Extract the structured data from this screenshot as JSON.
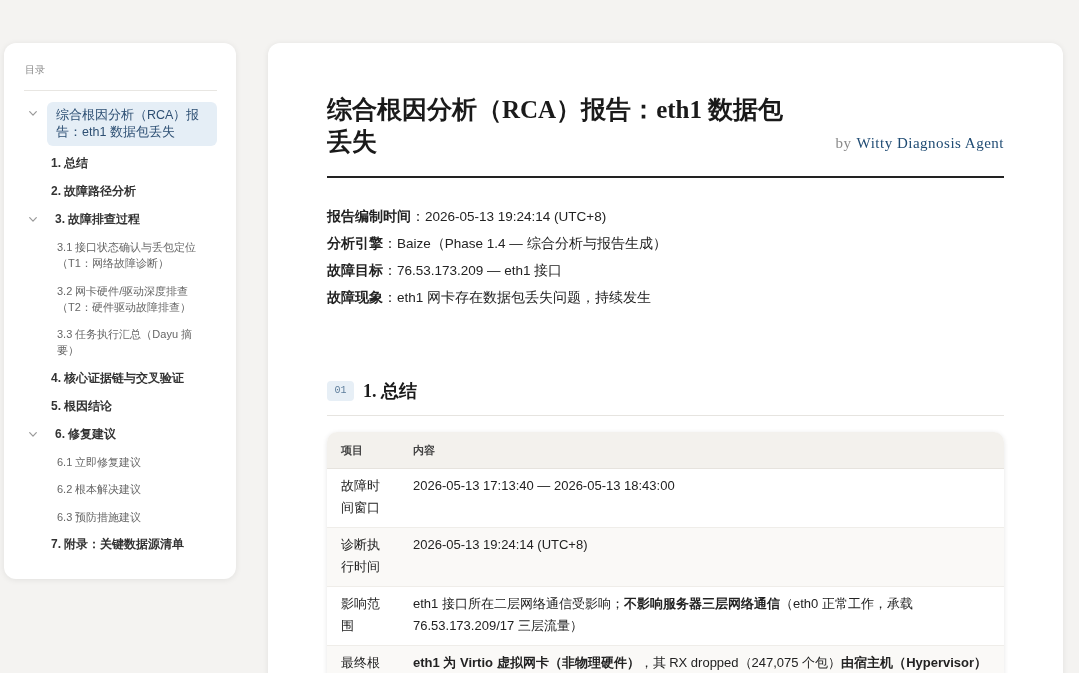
{
  "toc": {
    "title": "目录",
    "items": [
      {
        "label": "综合根因分析（RCA）报告：eth1 数据包丢失",
        "selected": true,
        "expanded": true,
        "children": [
          {
            "label": "1. 总结",
            "selected": false
          },
          {
            "label": "2. 故障路径分析",
            "selected": false
          },
          {
            "label": "3. 故障排查过程",
            "selected": false,
            "expanded": true,
            "children": [
              {
                "label": "3.1 接口状态确认与丢包定位（T1：网络故障诊断）",
                "selected": false
              },
              {
                "label": "3.2 网卡硬件/驱动深度排查（T2：硬件驱动故障排查）",
                "selected": false
              },
              {
                "label": "3.3 任务执行汇总（Dayu 摘要）",
                "selected": false
              }
            ]
          },
          {
            "label": "4. 核心证据链与交叉验证",
            "selected": false
          },
          {
            "label": "5. 根因结论",
            "selected": false
          },
          {
            "label": "6. 修复建议",
            "selected": false,
            "expanded": true,
            "children": [
              {
                "label": "6.1 立即修复建议",
                "selected": false
              },
              {
                "label": "6.2 根本解决建议",
                "selected": false
              },
              {
                "label": "6.3 预防措施建议",
                "selected": false
              }
            ]
          },
          {
            "label": "7. 附录：关键数据源清单",
            "selected": false
          }
        ]
      }
    ]
  },
  "report": {
    "title": "综合根因分析（RCA）报告：eth1 数据包丢失",
    "byline": {
      "prefix": "by",
      "author": "Witty Diagnosis Agent"
    },
    "meta": [
      "**报告编制时间**：2026-05-13 19:24:14 (UTC+8)",
      "**分析引擎**：Baize（Phase 1.4 — 综合分析与报告生成）",
      "**故障目标**：76.53.173.209 — eth1 接口",
      "**故障现象**：eth1 网卡存在数据包丢失问题，持续发生"
    ],
    "sections": [
      {
        "number": "01",
        "heading": "1. 总结",
        "table": {
          "columns": [
            "项目",
            "内容"
          ],
          "rows": [
            [
              "故障时间窗口",
              "2026-05-13 17:13:40 — 2026-05-13 18:43:00"
            ],
            [
              "诊断执行时间",
              "2026-05-13 19:24:14 (UTC+8)"
            ],
            [
              "影响范围",
              "eth1 接口所在二层网络通信受影响；**不影响服务器三层网络通信**（eth0 正常工作，承载 76.53.173.209/17 三层流量）"
            ],
            [
              "最终根",
              "**eth1 为 Virtio 虚拟网卡（非物理硬件）**，其 RX dropped（247,075 个包）**由宿主机（Hypervisor）**"
            ]
          ]
        }
      }
    ]
  }
}
